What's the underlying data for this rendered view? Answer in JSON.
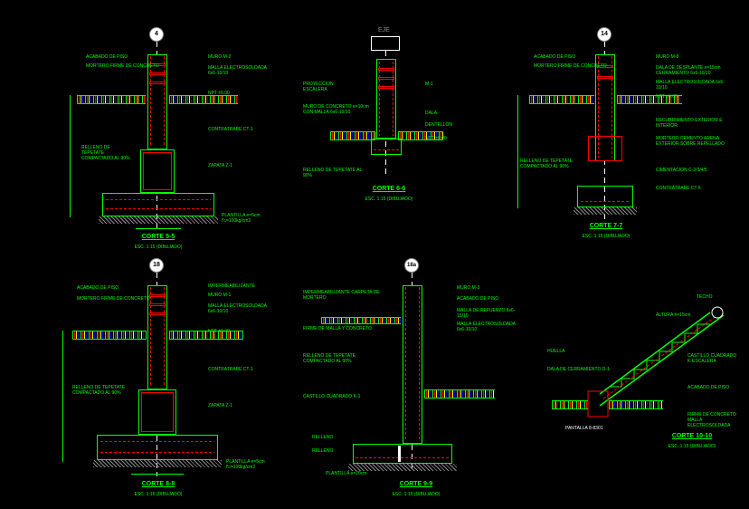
{
  "sections": {
    "corte55": {
      "title": "CORTE 5-5",
      "subtitle": "ESC. 1:15 (DIBUJADO)",
      "axis": "4",
      "plantilla": "PLANTILLA e=5cm f'c=100kg/cm2",
      "labels": {
        "l1": "ACABADO DE PISO",
        "l2": "MORTERO FIRME DE CONCRETO",
        "l3": "RELLENO DE TEPETATE COMPACTADO AL 90%",
        "l4": "MURO M-2",
        "l5": "MALLA ELECTROSOLDADA 6x6-10/10",
        "l6": "NPT ±0.00",
        "l7": "CONTRATRABE CT-1",
        "l8": "ZAPATA Z-1"
      }
    },
    "corte6": {
      "title": "CORTE 6-6",
      "subtitle": "ESC. 1:15 (DIBUJADO)",
      "axis": "EJE",
      "labels": {
        "l1": "PROYECCION ESCALERA",
        "l2": "MURO DE CONCRETO e=10cm CON MALLA 6x6-10/10",
        "l3": "RELLENO DE TEPETATE AL 90%",
        "l4": "M-1",
        "l5": "DALA",
        "l6": "DENTELLON",
        "l7": "NPT ±0.00"
      }
    },
    "corte77": {
      "title": "CORTE 7-7",
      "subtitle": "ESC. 1:15 (DIBUJADO)",
      "axis": "14",
      "labels": {
        "l1": "ACABADO DE PISO",
        "l2": "MORTERO FIRME DE CONCRETO",
        "l3": "MURO M-8",
        "l4": "DALA DE DESPLANTE e=15cm CERRAMIENTO 6x6-10/10",
        "l5": "MALLA ELECTROSOLDADA 6x6-10/10",
        "l6": "NPT ±0.00",
        "l7": "RECUBRIMIENTO EXTERIOR E INTERIOR",
        "l8": "MORTERO CEMENTO ARENA EXTERIOR SOBRE REPELLADO",
        "l9": "RELLENO DE TEPETATE COMPACTADO AL 90%",
        "l10": "CIMENTACION C-2/3/4/5",
        "l11": "CONTRATRABE CT-5"
      }
    },
    "corte88": {
      "title": "CORTE 8-8",
      "subtitle": "ESC. 1:15 (DIBUJADO)",
      "axis": "18",
      "plantilla": "PLANTILLA e=5cm f'c=100kg/cm2",
      "labels": {
        "l1": "ACABADO DE PISO",
        "l2": "MORTERO FIRME DE CONCRETO",
        "l3": "RELLENO DE TEPETATE COMPACTADO AL 90%",
        "l4": "IMPERMEABILIZANTE",
        "l5": "MURO M-1",
        "l6": "MALLA ELECTROSOLDADA 6x6-10/10",
        "l7": "NPT ±0.00",
        "l8": "CONTRATRABE CT-1",
        "l9": "ZAPATA Z-1"
      }
    },
    "corte99": {
      "title": "CORTE 9-9",
      "subtitle": "ESC. 1:15 (DIBUJADO)",
      "axis": "18a",
      "plantilla": "PLANTILLA e=20cm",
      "labels": {
        "l1": "IMPERMEABILIZANTE CARPETA DE MORTERO",
        "l2": "FIRME DE MALLA Y CONCRETO",
        "l3": "RELLENO DE TEPETATE COMPACTADO AL 90%",
        "l4": "MURO M-3",
        "l5": "ACABADO DE PISO",
        "l6": "MALLA DE REFUERZO 6x6-10/10",
        "l7": "MALLA ELECTROSOLDADA 6x6-10/10",
        "l8": "CASTILLO CUADRADO K-1",
        "l9": "RELLENO",
        "l10": "RELLENO"
      }
    },
    "corte1010": {
      "title": "CORTE 10-10",
      "subtitle": "ESC. 1:15 (DIBUJADO)",
      "labels": {
        "l1": "TECHO",
        "l2": "DALA DE CERRAMIENTO D-1",
        "l3": "CASTILLO CUADRADO K-ESCALERA",
        "l4": "ACABADO DE PISO",
        "l5": "FIRME DE CONCRETO MALLA ELECTROSOLDADA",
        "l6": "ALTURA h=15cm",
        "l7": "HUELLA"
      }
    }
  }
}
